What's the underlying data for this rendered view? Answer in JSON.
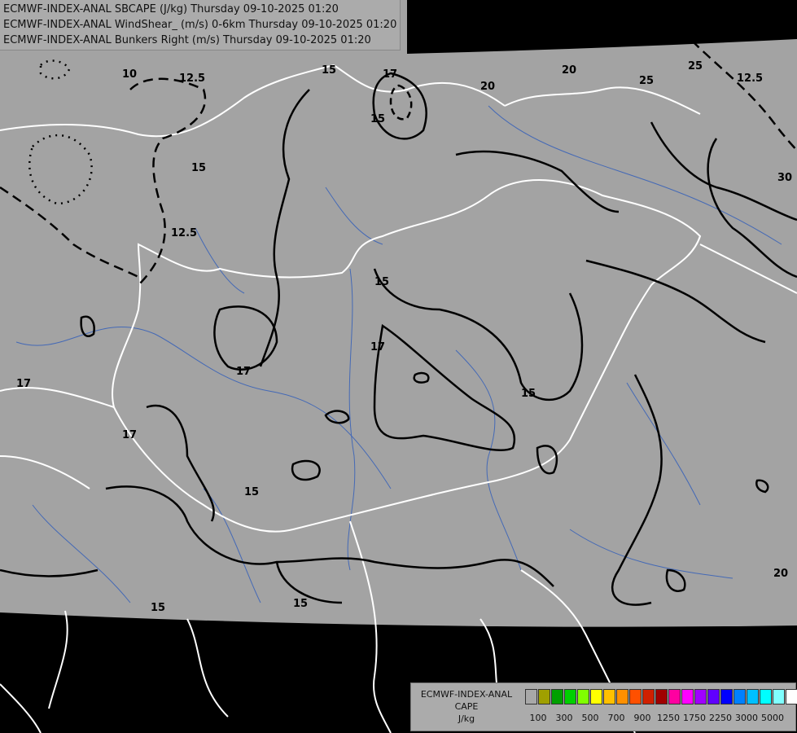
{
  "titles": [
    "ECMWF-INDEX-ANAL SBCAPE (J/kg) Thursday 09-10-2025 01:20",
    "ECMWF-INDEX-ANAL WindShear_ (m/s) 0-6km Thursday 09-10-2025 01:20",
    "ECMWF-INDEX-ANAL Bunkers Right (m/s) Thursday 09-10-2025 01:20"
  ],
  "contour_labels": [
    "10",
    "12.5",
    "12.5",
    "15",
    "15",
    "15",
    "15",
    "15",
    "15",
    "15",
    "17",
    "17",
    "17",
    "17",
    "17",
    "20",
    "20",
    "20",
    "25",
    "25",
    "12.5",
    "15",
    "30"
  ],
  "legend": {
    "line1": "ECMWF-INDEX-ANAL",
    "line2": "CAPE",
    "line3": "J/kg",
    "colors": [
      "#a8a8a8",
      "#a0a000",
      "#00a000",
      "#00d000",
      "#80ff00",
      "#ffff00",
      "#ffc000",
      "#ff9000",
      "#ff5000",
      "#d02000",
      "#a00000",
      "#ff00a0",
      "#ff00ff",
      "#a000ff",
      "#6000ff",
      "#0000ff",
      "#0080ff",
      "#00c0ff",
      "#00ffff",
      "#80ffff",
      "#ffffff"
    ],
    "ticks": [
      "100",
      "300",
      "500",
      "700",
      "900",
      "1250",
      "1750",
      "2250",
      "3000",
      "5000"
    ]
  }
}
